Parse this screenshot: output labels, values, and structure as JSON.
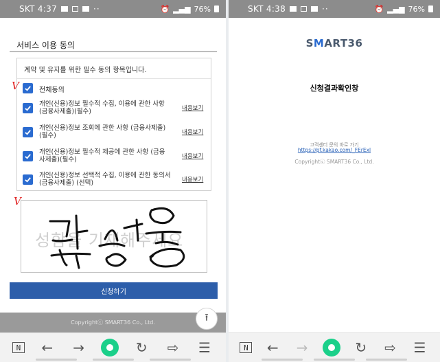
{
  "left": {
    "status": {
      "carrier": "SKT 4:37",
      "battery": "76%"
    },
    "section_title": "서비스 이용 동의",
    "agree_heading": "계약 및 유지를 위한 필수 동의 항목입니다.",
    "all_label": "전체동의",
    "items": [
      {
        "text": "개인(신용)정보 필수적 수집, 이용에 관한 사항 (금융사제출)(필수)",
        "link": "내용보기"
      },
      {
        "text": "개인(신용)정보 조회에 관한 사항 (금융사제출)(필수)",
        "link": "내용보기"
      },
      {
        "text": "개인(신용)정보 필수적 제공에 관한 사항 (금융사제출)(필수)",
        "link": "내용보기"
      },
      {
        "text": "개인(신용)정보 선택적 수집, 이용에 관한 동의서 (금융사제출) (선택)",
        "link": "내용보기"
      }
    ],
    "annotation_marks": [
      "V",
      "V"
    ],
    "signature_watermark": "성함을 기재해주세요",
    "submit_label": "신청하기",
    "copyright": "Copyrightⓒ SMART36 Co., Ltd.",
    "to_top_icon": "arrow-up-icon",
    "nav_n": "N"
  },
  "right": {
    "status": {
      "carrier": "SKT 4:38",
      "battery": "76%"
    },
    "logo": {
      "pre": "S",
      "post": "ART36"
    },
    "result_title": "신청결과확인창",
    "cs_label": "고객센터 문의 바로 가기",
    "cs_link": "https://pf.kakao.com/_FErExl",
    "copyright": "Copyrightⓒ SMART36 Co., Ltd.",
    "nav_n": "N"
  },
  "colors": {
    "accent": "#2a6bd0",
    "button": "#2d5eaa",
    "nav_home": "#1bd08a",
    "annotation": "#e02020"
  }
}
